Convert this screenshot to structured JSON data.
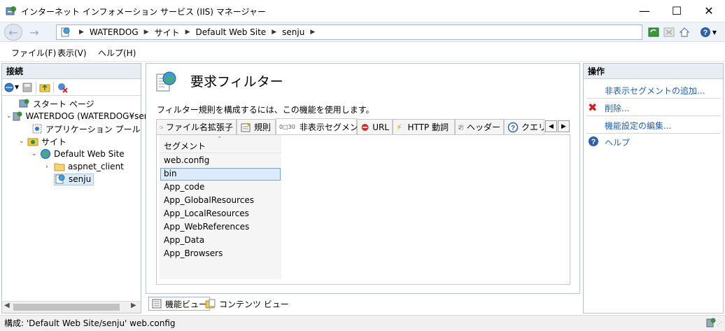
{
  "window": {
    "title": "インターネット インフォメーション サービス (IIS) マネージャー",
    "minimize": "—",
    "maximize": "☐",
    "close": "✕"
  },
  "address": {
    "back": "←",
    "forward": "→",
    "crumbs": [
      "WATERDOG",
      "サイト",
      "Default Web Site",
      "senju"
    ]
  },
  "menu": {
    "file": "ファイル(F)",
    "view": "表示(V)",
    "help": "ヘルプ(H)"
  },
  "connections": {
    "header": "接続",
    "tree": {
      "start_page": "スタート ページ",
      "server": "WATERDOG (WATERDOG¥sen",
      "app_pools": "アプリケーション プール",
      "sites": "サイト",
      "default_site": "Default Web Site",
      "aspnet_client": "aspnet_client",
      "senju": "senju"
    }
  },
  "feature": {
    "title": "要求フィルター",
    "description": "フィルター規則を構成するには、この機能を使用します。",
    "tabs": [
      "ファイル名拡張子",
      "規則",
      "非表示セグメント",
      "URL",
      "HTTP 動詞",
      "ヘッダー",
      "クエリ:"
    ],
    "active_tab": "非表示セグメント",
    "column_header": "セグメント",
    "segments": [
      "web.config",
      "bin",
      "App_code",
      "App_GlobalResources",
      "App_LocalResources",
      "App_WebReferences",
      "App_Data",
      "App_Browsers"
    ],
    "selected_segment": "bin"
  },
  "views": {
    "feature_view": "機能ビュー",
    "content_view": "コンテンツ ビュー"
  },
  "actions": {
    "header": "操作",
    "add": "非表示セグメントの追加...",
    "remove": "削除...",
    "edit_settings": "機能設定の編集...",
    "help": "ヘルプ"
  },
  "status": {
    "text": "構成: 'Default Web Site/senju' web.config"
  },
  "colors": {
    "link": "#1f5fb0",
    "selection_border": "#7da2ce",
    "selection_bg": "#dcebfc",
    "panel_header": "#e8edf3"
  }
}
